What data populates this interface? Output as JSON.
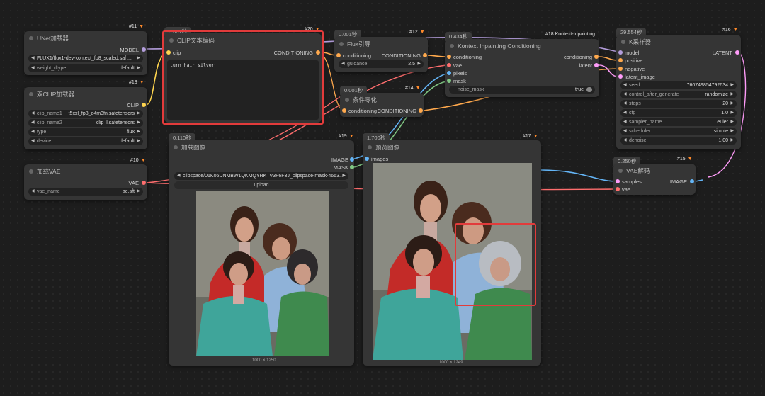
{
  "nodes": {
    "n11": {
      "title": "UNet加载器",
      "id": "#11",
      "out_label": "MODEL",
      "unet_name": "FLUX1/flux1-dev-kontext_fp8_scaled.saf ...",
      "weight_dtype_label": "weight_dtype",
      "weight_dtype": "default"
    },
    "n13": {
      "title": "双CLIP加载器",
      "id": "#13",
      "out_label": "CLIP",
      "clip_name1_label": "clip_name1",
      "clip_name1": "t5xxl_fp8_e4m3fn.safetensors",
      "clip_name2_label": "clip_name2",
      "clip_name2": "clip_l.safetensors",
      "type_label": "type",
      "type": "flux",
      "device_label": "device",
      "device": "default"
    },
    "n10": {
      "title": "加载VAE",
      "id": "#10",
      "out_label": "VAE",
      "vae_name_label": "vae_name",
      "vae_name": "ae.sft"
    },
    "n20": {
      "title": "CLIP文本编码",
      "id": "#20",
      "time": "0.007秒",
      "in_clip": "clip",
      "out_label": "CONDITIONING",
      "text": "turn hair silver"
    },
    "n12": {
      "title": "Flux引导",
      "id": "#12",
      "time": "0.001秒",
      "in_label": "conditioning",
      "out_label": "CONDITIONING",
      "guidance_label": "guidance",
      "guidance": "2.5"
    },
    "n14": {
      "title": "条件零化",
      "id": "#14",
      "time": "0.001秒",
      "in_label": "conditioning",
      "out_label": "CONDITIONING"
    },
    "n18": {
      "title": "Kontext Inpainting Conditioning",
      "id": "#18 Kontext-Inpainting",
      "time": "0.434秒",
      "in_conditioning": "conditioning",
      "in_vae": "vae",
      "in_pixels": "pixels",
      "in_mask": "mask",
      "out_conditioning": "conditioning",
      "out_latent": "latent",
      "noise_mask_label": "noise_mask",
      "noise_mask": "true"
    },
    "n16": {
      "title": "K采样器",
      "id": "#16",
      "time": "29.554秒",
      "in_model": "model",
      "in_positive": "positive",
      "in_negative": "negative",
      "in_latent": "latent_image",
      "out_label": "LATENT",
      "widgets": [
        {
          "label": "seed",
          "value": "760749854792634"
        },
        {
          "label": "control_after_generate",
          "value": "randomize"
        },
        {
          "label": "steps",
          "value": "20"
        },
        {
          "label": "cfg",
          "value": "1.0"
        },
        {
          "label": "sampler_name",
          "value": "euler"
        },
        {
          "label": "scheduler",
          "value": "simple"
        },
        {
          "label": "denoise",
          "value": "1.00"
        }
      ]
    },
    "n15": {
      "title": "VAE解码",
      "id": "#15",
      "time": "0.250秒",
      "in_samples": "samples",
      "in_vae": "vae",
      "out_label": "IMAGE"
    },
    "n19": {
      "title": "加载图像",
      "id": "#19",
      "time": "0.110秒",
      "out_image": "IMAGE",
      "out_mask": "MASK",
      "image_value": "clipspace/01K06DNMBW1QKMQYRKTV3F6F3J_clipspace-mask-4663...",
      "upload_label": "upload",
      "caption": "1000 × 1250"
    },
    "n17": {
      "title": "预览图像",
      "id": "#17",
      "time": "1.700秒",
      "in_images": "images",
      "caption": "1000 × 1249"
    }
  },
  "colors": {
    "model": "#b39ddb",
    "clip": "#ffd54f",
    "vae": "#ff6e6e",
    "conditioning": "#ffa94d",
    "latent": "#ff9cf9",
    "image": "#64b5f6",
    "mask": "#81c784",
    "highlight": "#e23b3b"
  }
}
